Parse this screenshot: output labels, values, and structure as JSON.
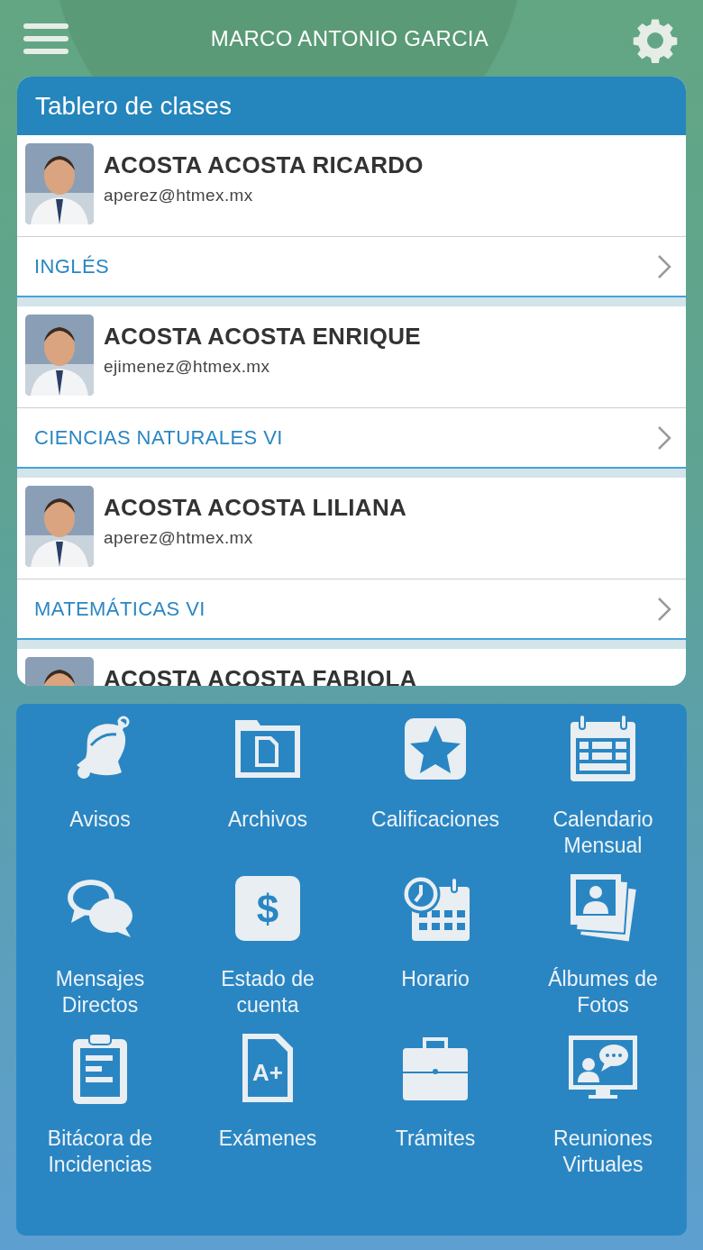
{
  "header": {
    "title": "MARCO ANTONIO GARCIA"
  },
  "board": {
    "title": "Tablero de clases",
    "entries": [
      {
        "name": "ACOSTA ACOSTA RICARDO",
        "email": "aperez@htmex.mx",
        "subject": "INGLÉS"
      },
      {
        "name": "ACOSTA ACOSTA ENRIQUE",
        "email": "ejimenez@htmex.mx",
        "subject": "CIENCIAS NATURALES VI"
      },
      {
        "name": "ACOSTA ACOSTA LILIANA",
        "email": "aperez@htmex.mx",
        "subject": "MATEMÁTICAS VI"
      },
      {
        "name": "ACOSTA ACOSTA FABIOLA"
      }
    ]
  },
  "menu": [
    {
      "label": "Avisos",
      "kind": "bell"
    },
    {
      "label": "Archivos",
      "kind": "folder"
    },
    {
      "label": "Calificaciones",
      "kind": "star"
    },
    {
      "label": "Calendario Mensual",
      "kind": "calendar"
    },
    {
      "label": "Mensajes Directos",
      "kind": "chat"
    },
    {
      "label": "Estado de cuenta",
      "kind": "money",
      "glyph": "$"
    },
    {
      "label": "Horario",
      "kind": "schedule"
    },
    {
      "label": "Álbumes de Fotos",
      "kind": "photos"
    },
    {
      "label": "Bitácora de Incidencias",
      "kind": "clipboard"
    },
    {
      "label": "Exámenes",
      "kind": "exam",
      "glyph": "A+"
    },
    {
      "label": "Trámites",
      "kind": "briefcase"
    },
    {
      "label": "Reuniones Virtuales",
      "kind": "meeting"
    }
  ]
}
